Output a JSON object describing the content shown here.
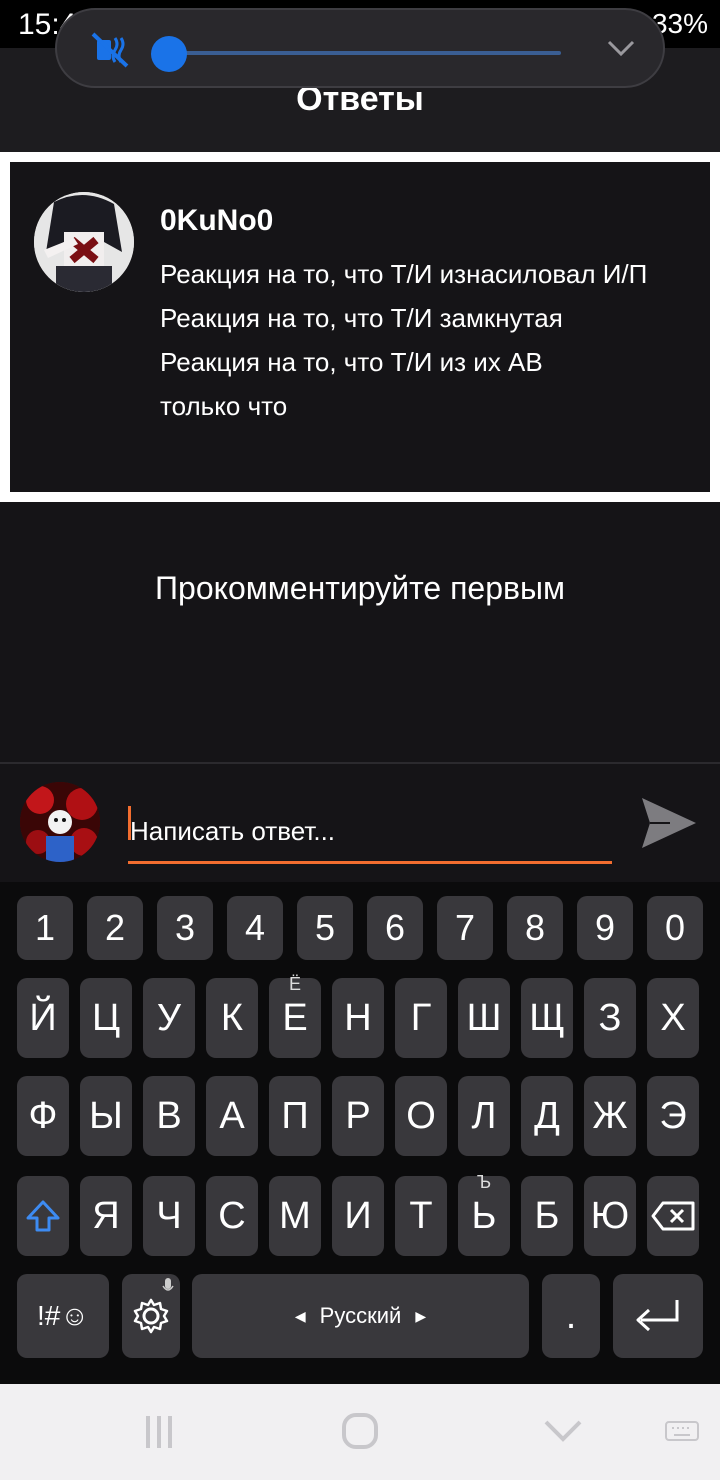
{
  "status": {
    "time": "15:42",
    "battery": "33%"
  },
  "header": {
    "title": "Ответы"
  },
  "volume": {
    "level": 0.0,
    "muted": true
  },
  "post": {
    "author": "0KuNo0",
    "lines": [
      "Реакция на то, что Т/И изнасиловал И/П",
      "Реакция на то, что Т/И замкнутая",
      "Реакция на то, что Т/И из их АВ"
    ],
    "time": "только что"
  },
  "comments": {
    "empty_text": "Прокомментируйте первым"
  },
  "reply": {
    "placeholder": "Написать ответ..."
  },
  "keyboard": {
    "numbers": [
      "1",
      "2",
      "3",
      "4",
      "5",
      "6",
      "7",
      "8",
      "9",
      "0"
    ],
    "row1": [
      "Й",
      "Ц",
      "У",
      "К",
      "Е",
      "Н",
      "Г",
      "Ш",
      "Щ",
      "З",
      "Х"
    ],
    "row1_hint_e": "Ё",
    "row2": [
      "Ф",
      "Ы",
      "В",
      "А",
      "П",
      "Р",
      "О",
      "Л",
      "Д",
      "Ж",
      "Э"
    ],
    "row3": [
      "Я",
      "Ч",
      "С",
      "М",
      "И",
      "Т",
      "Ь",
      "Б",
      "Ю"
    ],
    "row3_hint_soft": "Ъ",
    "symbols_label": "!#☺",
    "space_label": "Русский",
    "period_label": "."
  },
  "colors": {
    "accent": "#f26d2f",
    "volume": "#1a73e8"
  }
}
